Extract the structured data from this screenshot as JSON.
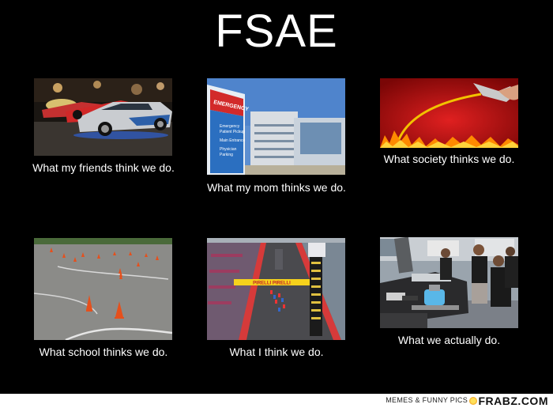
{
  "title": "FSAE",
  "panels": [
    {
      "caption": "What my friends think we do.",
      "image": "street-racing-cars"
    },
    {
      "caption": "What my mom thinks we do.",
      "image": "hospital-emergency-building",
      "sign": {
        "emergency": "EMERGENCY",
        "lines": [
          "Emergency",
          "Patient Pickup",
          "Main Entrance",
          "Physician",
          "Parking"
        ]
      }
    },
    {
      "caption": "What society thinks we do.",
      "image": "gas-nozzle-over-fire"
    },
    {
      "caption": "What school thinks we do.",
      "image": "cones-on-asphalt"
    },
    {
      "caption": "What I think we do.",
      "image": "race-track-start",
      "banner": "PIRELLI PIRELLI"
    },
    {
      "caption": "What we actually do.",
      "image": "students-with-race-car"
    }
  ],
  "footer": {
    "left": "MEMES & FUNNY PICS",
    "right": "FRABZ.COM"
  }
}
